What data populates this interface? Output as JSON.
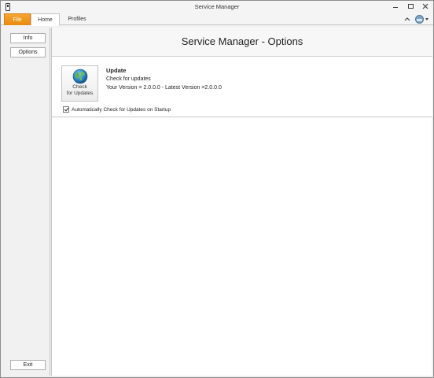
{
  "window": {
    "title": "Service Manager"
  },
  "ribbon": {
    "tabs": [
      {
        "label": "File",
        "active": true
      },
      {
        "label": "Home"
      },
      {
        "label": "Profiles"
      }
    ]
  },
  "sidebar": {
    "info_label": "Info",
    "options_label": "Options",
    "exit_label": "Exit"
  },
  "main": {
    "title": "Service Manager - Options",
    "update": {
      "button_line1": "Check",
      "button_line2": "for Updates",
      "heading": "Update",
      "subtitle": "Check for updates",
      "version_text": "Your Version = 2.0.0.0 - Latest Version =2.0.0.0",
      "auto_check_label": "Automatically Check for Updates on Startup",
      "auto_check_checked": true
    }
  },
  "colors": {
    "file_tab": "#f39c12",
    "header_bg": "#f7f7f7",
    "sidebar_bg": "#f1f1f1"
  }
}
